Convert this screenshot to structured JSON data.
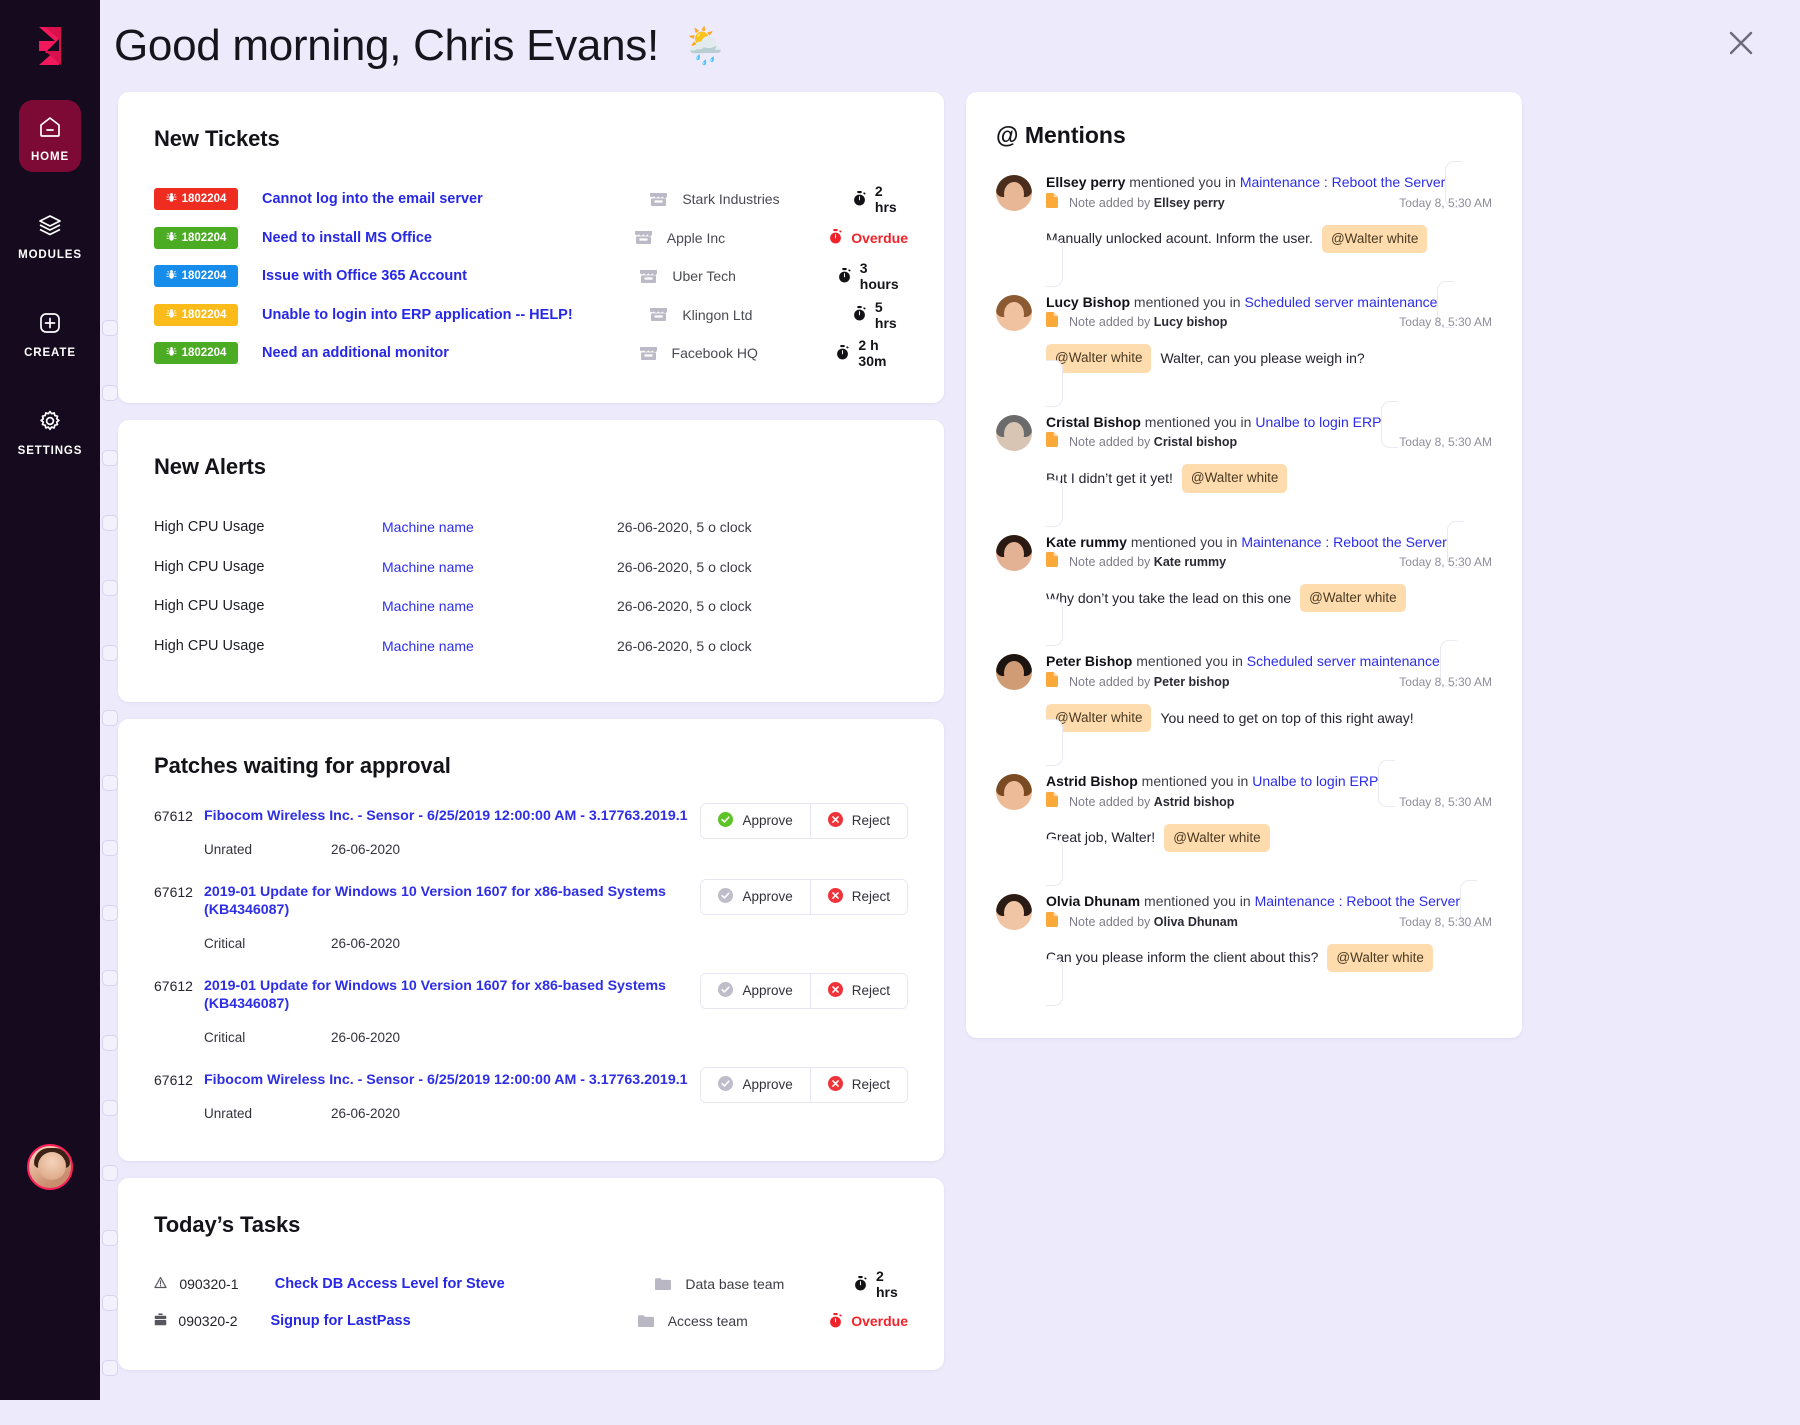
{
  "sidebar": {
    "logo_icon": "app-logo-icon",
    "items": [
      {
        "label": "HOME",
        "icon": "home-icon",
        "active": true
      },
      {
        "label": "MODULES",
        "icon": "layers-icon",
        "active": false
      },
      {
        "label": "CREATE",
        "icon": "plus-square-icon",
        "active": false
      },
      {
        "label": "SETTINGS",
        "icon": "gear-icon",
        "active": false
      }
    ],
    "user_avatar": "user-avatar"
  },
  "header": {
    "greeting": "Good morning, Chris Evans!",
    "weather_icon": "🌦️",
    "close_icon": "close-icon"
  },
  "tickets": {
    "title": "New Tickets",
    "rows": [
      {
        "id": "1802204",
        "color": "#ee2c20",
        "subject": "Cannot log into the email server",
        "company": "Stark Industries",
        "time": "2 hrs",
        "overdue": false
      },
      {
        "id": "1802204",
        "color": "#4bab22",
        "subject": "Need to install MS Office",
        "company": "Apple Inc",
        "time": "Overdue",
        "overdue": true
      },
      {
        "id": "1802204",
        "color": "#168dea",
        "subject": "Issue with Office 365 Account",
        "company": "Uber Tech",
        "time": "3 hours",
        "overdue": false
      },
      {
        "id": "1802204",
        "color": "#fbbb1b",
        "subject": "Unable to login into ERP application -- HELP!",
        "company": "Klingon Ltd",
        "time": "5 hrs",
        "overdue": false
      },
      {
        "id": "1802204",
        "color": "#4bab22",
        "subject": "Need an additional monitor",
        "company": "Facebook HQ",
        "time": "2 h 30m",
        "overdue": false
      }
    ]
  },
  "alerts": {
    "title": "New Alerts",
    "rows": [
      {
        "name": "High CPU Usage",
        "machine": "Machine name",
        "date": "26-06-2020,  5 o clock"
      },
      {
        "name": "High CPU Usage",
        "machine": "Machine name",
        "date": "26-06-2020,  5 o clock"
      },
      {
        "name": "High CPU Usage",
        "machine": "Machine name",
        "date": "26-06-2020,  5 o clock"
      },
      {
        "name": "High CPU Usage",
        "machine": "Machine name",
        "date": "26-06-2020,  5 o clock"
      }
    ]
  },
  "patches": {
    "title": "Patches waiting for approval",
    "approve_label": "Approve",
    "reject_label": "Reject",
    "rows": [
      {
        "id": "67612",
        "title": "Fibocom Wireless Inc. - Sensor - 6/25/2019 12:00:00 AM - 3.17763.2019.1",
        "severity": "Unrated",
        "date": "26-06-2020",
        "approve_active": true
      },
      {
        "id": "67612",
        "title": "2019-01 Update for Windows 10 Version 1607 for x86-based Systems (KB4346087)",
        "severity": "Critical",
        "date": "26-06-2020",
        "approve_active": false
      },
      {
        "id": "67612",
        "title": "2019-01 Update for Windows 10 Version 1607 for x86-based Systems (KB4346087)",
        "severity": "Critical",
        "date": "26-06-2020",
        "approve_active": false
      },
      {
        "id": "67612",
        "title": "Fibocom Wireless Inc. - Sensor - 6/25/2019 12:00:00 AM - 3.17763.2019.1",
        "severity": "Unrated",
        "date": "26-06-2020",
        "approve_active": false
      }
    ]
  },
  "tasks": {
    "title": "Today’s Tasks",
    "rows": [
      {
        "icon": "warning-triangle-icon",
        "id": "090320-1",
        "title": "Check DB Access Level for Steve",
        "team": "Data base team",
        "time": "2 hrs",
        "overdue": false
      },
      {
        "icon": "briefcase-icon",
        "id": "090320-2",
        "title": "Signup for LastPass",
        "team": "Access team",
        "time": "Overdue",
        "overdue": true
      }
    ]
  },
  "mentions": {
    "title": "@ Mentions",
    "mentioned_text": "mentioned you in",
    "note_prefix": "Note added by",
    "items": [
      {
        "name": "Ellsey perry",
        "link": "Maintenance : Reboot the Server",
        "note_by": "Ellsey perry",
        "time": "Today 8, 5:30 AM",
        "text": "Manually unlocked acount. Inform the user.",
        "tag": "@Walter white",
        "tag_first": false,
        "hair": "#4a2d1c",
        "skin": "#e8b795"
      },
      {
        "name": "Lucy Bishop",
        "link": "Scheduled server maintenance",
        "note_by": "Lucy bishop",
        "time": "Today 8, 5:30 AM",
        "text": "Walter, can you please weigh in?",
        "tag": "@Walter white",
        "tag_first": true,
        "hair": "#8c5a32",
        "skin": "#f0c2a0"
      },
      {
        "name": "Cristal Bishop",
        "link": "Unalbe to login ERP",
        "note_by": "Cristal bishop",
        "time": "Today 8, 5:30 AM",
        "text": "But I didn’t get it yet!",
        "tag": "@Walter white",
        "tag_first": false,
        "hair": "#6b6b6b",
        "skin": "#d8c5b4"
      },
      {
        "name": "Kate rummy",
        "link": "Maintenance : Reboot the Server",
        "note_by": "Kate rummy",
        "time": "Today 8, 5:30 AM",
        "text": "Why don’t you take the lead on this one",
        "tag": "@Walter white",
        "tag_first": false,
        "hair": "#2b1a12",
        "skin": "#e3b193"
      },
      {
        "name": "Peter Bishop",
        "link": "Scheduled server maintenance",
        "note_by": "Peter bishop",
        "time": "Today 8, 5:30 AM",
        "text": "You need to get on top of this right away!",
        "tag": "@Walter white",
        "tag_first": true,
        "hair": "#1c1410",
        "skin": "#cf9c75"
      },
      {
        "name": "Astrid Bishop",
        "link": "Unalbe to login ERP",
        "note_by": "Astrid bishop",
        "time": "Today 8, 5:30 AM",
        "text": "Great job, Walter!",
        "tag": "@Walter white",
        "tag_first": false,
        "hair": "#7a4a22",
        "skin": "#edbb98"
      },
      {
        "name": "Olvia Dhunam",
        "link": "Maintenance : Reboot the Server",
        "note_by": "Oliva Dhunam",
        "time": "Today 8, 5:30 AM",
        "text": "Can you please inform the client about this?",
        "tag": "@Walter white",
        "tag_first": false,
        "hair": "#2a1c14",
        "skin": "#f0c5a5"
      }
    ]
  }
}
